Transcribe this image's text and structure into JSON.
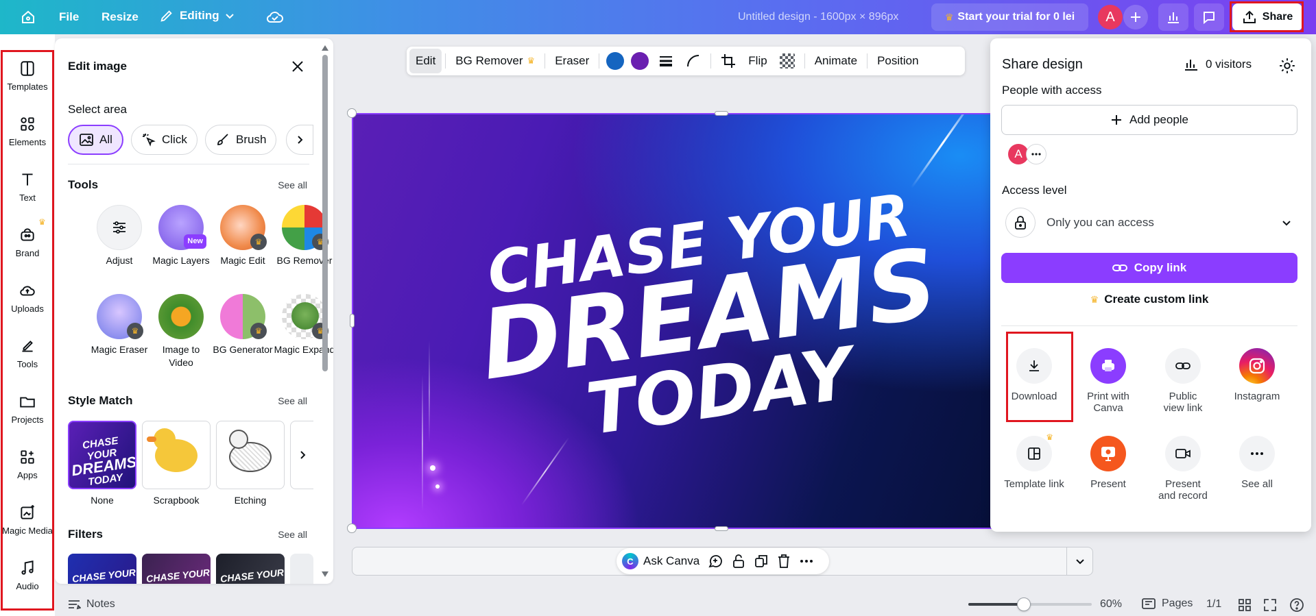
{
  "topbar": {
    "file": "File",
    "resize": "Resize",
    "editing": "Editing",
    "design_title": "Untitled design - 1600px × 896px",
    "trial": "Start your trial for 0 lei",
    "avatar": "A",
    "share": "Share"
  },
  "rail": [
    {
      "label": "Templates"
    },
    {
      "label": "Elements"
    },
    {
      "label": "Text"
    },
    {
      "label": "Brand"
    },
    {
      "label": "Uploads"
    },
    {
      "label": "Tools"
    },
    {
      "label": "Projects"
    },
    {
      "label": "Apps"
    },
    {
      "label": "Magic Media"
    },
    {
      "label": "Audio"
    }
  ],
  "edit_panel": {
    "title": "Edit image",
    "select_area": "Select area",
    "chips": [
      "All",
      "Click",
      "Brush"
    ],
    "tools_title": "Tools",
    "see_all": "See all",
    "tools": [
      "Adjust",
      "Magic Layers",
      "Magic Edit",
      "BG Remover",
      "Magic Eraser",
      "Image to Video",
      "BG Generator",
      "Magic Expand"
    ],
    "new_badge": "New",
    "style_match_title": "Style Match",
    "styles": [
      "None",
      "Scrapbook",
      "Etching"
    ],
    "filters_title": "Filters",
    "thumb_text": "CHASE YOUR"
  },
  "toolbar": {
    "edit": "Edit",
    "bg_remover": "BG Remover",
    "eraser": "Eraser",
    "flip": "Flip",
    "animate": "Animate",
    "position": "Position",
    "colors": [
      "#1565c0",
      "#6a1fb0"
    ]
  },
  "canvas": {
    "line1": "CHASE YOUR",
    "line2": "DREAMS",
    "line3": "TODAY"
  },
  "ask": {
    "label": "Ask Canva"
  },
  "statusbar": {
    "notes": "Notes",
    "zoom": "60%",
    "pages": "Pages",
    "page_count": "1/1",
    "zoom_level": 0.45
  },
  "share": {
    "title": "Share design",
    "visitors": "0 visitors",
    "people_with_access": "People with access",
    "add_people": "Add people",
    "avatar": "A",
    "access_level": "Access level",
    "access_value": "Only you can access",
    "copy_link": "Copy link",
    "custom_link": "Create custom link",
    "options": [
      {
        "label": "Download"
      },
      {
        "label": "Print with Canva"
      },
      {
        "label": "Public view link"
      },
      {
        "label": "Instagram"
      },
      {
        "label": "Template link"
      },
      {
        "label": "Present"
      },
      {
        "label": "Present and record"
      },
      {
        "label": "See all"
      }
    ]
  }
}
